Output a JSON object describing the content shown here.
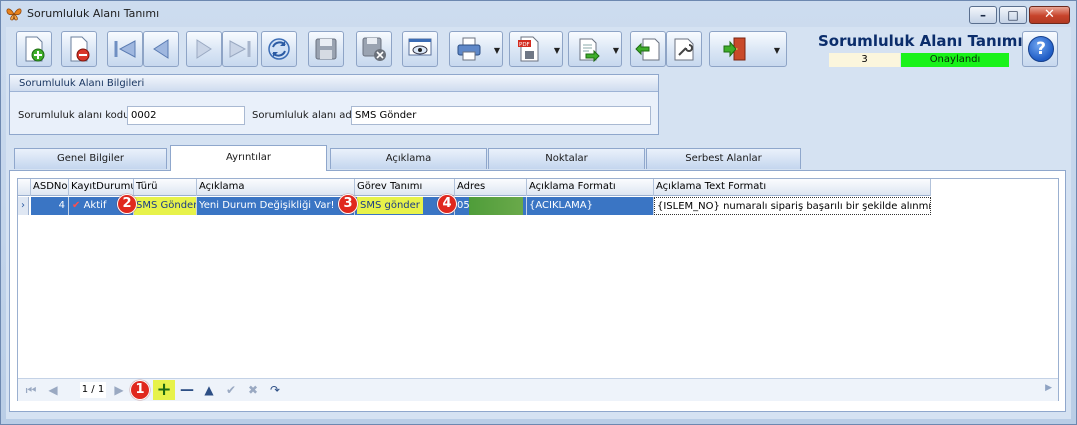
{
  "window": {
    "title": "Sorumluluk Alanı Tanımı",
    "icon": "butterfly-icon",
    "controls": [
      "minimize-icon",
      "maximize-icon",
      "close-icon"
    ]
  },
  "toolbar": {
    "buttons": [
      {
        "name": "new-record-button",
        "icon": "new-document-icon"
      },
      {
        "name": "delete-record-button",
        "icon": "delete-document-icon"
      },
      {
        "name": "first-record-button",
        "icon": "first-icon"
      },
      {
        "name": "previous-record-button",
        "icon": "previous-icon"
      },
      {
        "name": "next-record-button",
        "icon": "next-icon"
      },
      {
        "name": "last-record-button",
        "icon": "last-icon"
      },
      {
        "name": "refresh-button",
        "icon": "refresh-icon"
      },
      {
        "name": "save-button",
        "icon": "save-icon"
      },
      {
        "name": "save-close-button",
        "icon": "save-close-icon"
      },
      {
        "name": "preview-button",
        "icon": "preview-icon"
      },
      {
        "name": "print-button",
        "icon": "printer-icon"
      },
      {
        "name": "pdf-export-button",
        "icon": "pdf-icon"
      },
      {
        "name": "export-button",
        "icon": "export-icon"
      },
      {
        "name": "import-button",
        "icon": "import-icon"
      },
      {
        "name": "tools-button",
        "icon": "tools-icon"
      },
      {
        "name": "exit-button",
        "icon": "exit-door-icon"
      }
    ]
  },
  "header": {
    "title": "Sorumluluk Alanı Tanımı",
    "record_no": "3",
    "status": "Onaylandı",
    "status_color": "#19f219"
  },
  "groupbox": {
    "title": "Sorumluluk Alanı Bilgileri",
    "code_label": "Sorumluluk alanı kodu",
    "code_value": "0002",
    "name_label": "Sorumluluk alanı adı",
    "name_value": "SMS Gönder"
  },
  "tabs": [
    {
      "label": "Genel Bilgiler",
      "active": false
    },
    {
      "label": "Ayrıntılar",
      "active": true
    },
    {
      "label": "Açıklama",
      "active": false
    },
    {
      "label": "Noktalar",
      "active": false
    },
    {
      "label": "Serbest Alanlar",
      "active": false
    }
  ],
  "grid": {
    "columns": [
      "ASDNo",
      "KayıtDurumu",
      "Türü",
      "Açıklama",
      "Görev Tanımı",
      "Adres",
      "Açıklama Formatı",
      "Açıklama Text Formatı"
    ],
    "rows": [
      {
        "asdno": "4",
        "status": "Aktif",
        "type": "SMS Gönder",
        "description": "Yeni Durum Değişikliği Var!",
        "task": "SMS gönder",
        "address": "05",
        "format": "{ACIKLAMA}",
        "text_format": "{ISLEM_NO} numaralı sipariş başarılı bir şekilde alınmıştır."
      }
    ]
  },
  "markers": [
    "1",
    "2",
    "3",
    "4"
  ],
  "navigator": {
    "position": "1 / 1",
    "buttons": [
      "first-icon",
      "previous-icon",
      "next-icon",
      "add-icon",
      "remove-icon",
      "up-icon",
      "confirm-icon",
      "cancel-icon",
      "refresh-icon"
    ]
  },
  "colors": {
    "highlight": "#e7f24a",
    "selection": "#3a75c4",
    "marker": "#e0281e"
  }
}
